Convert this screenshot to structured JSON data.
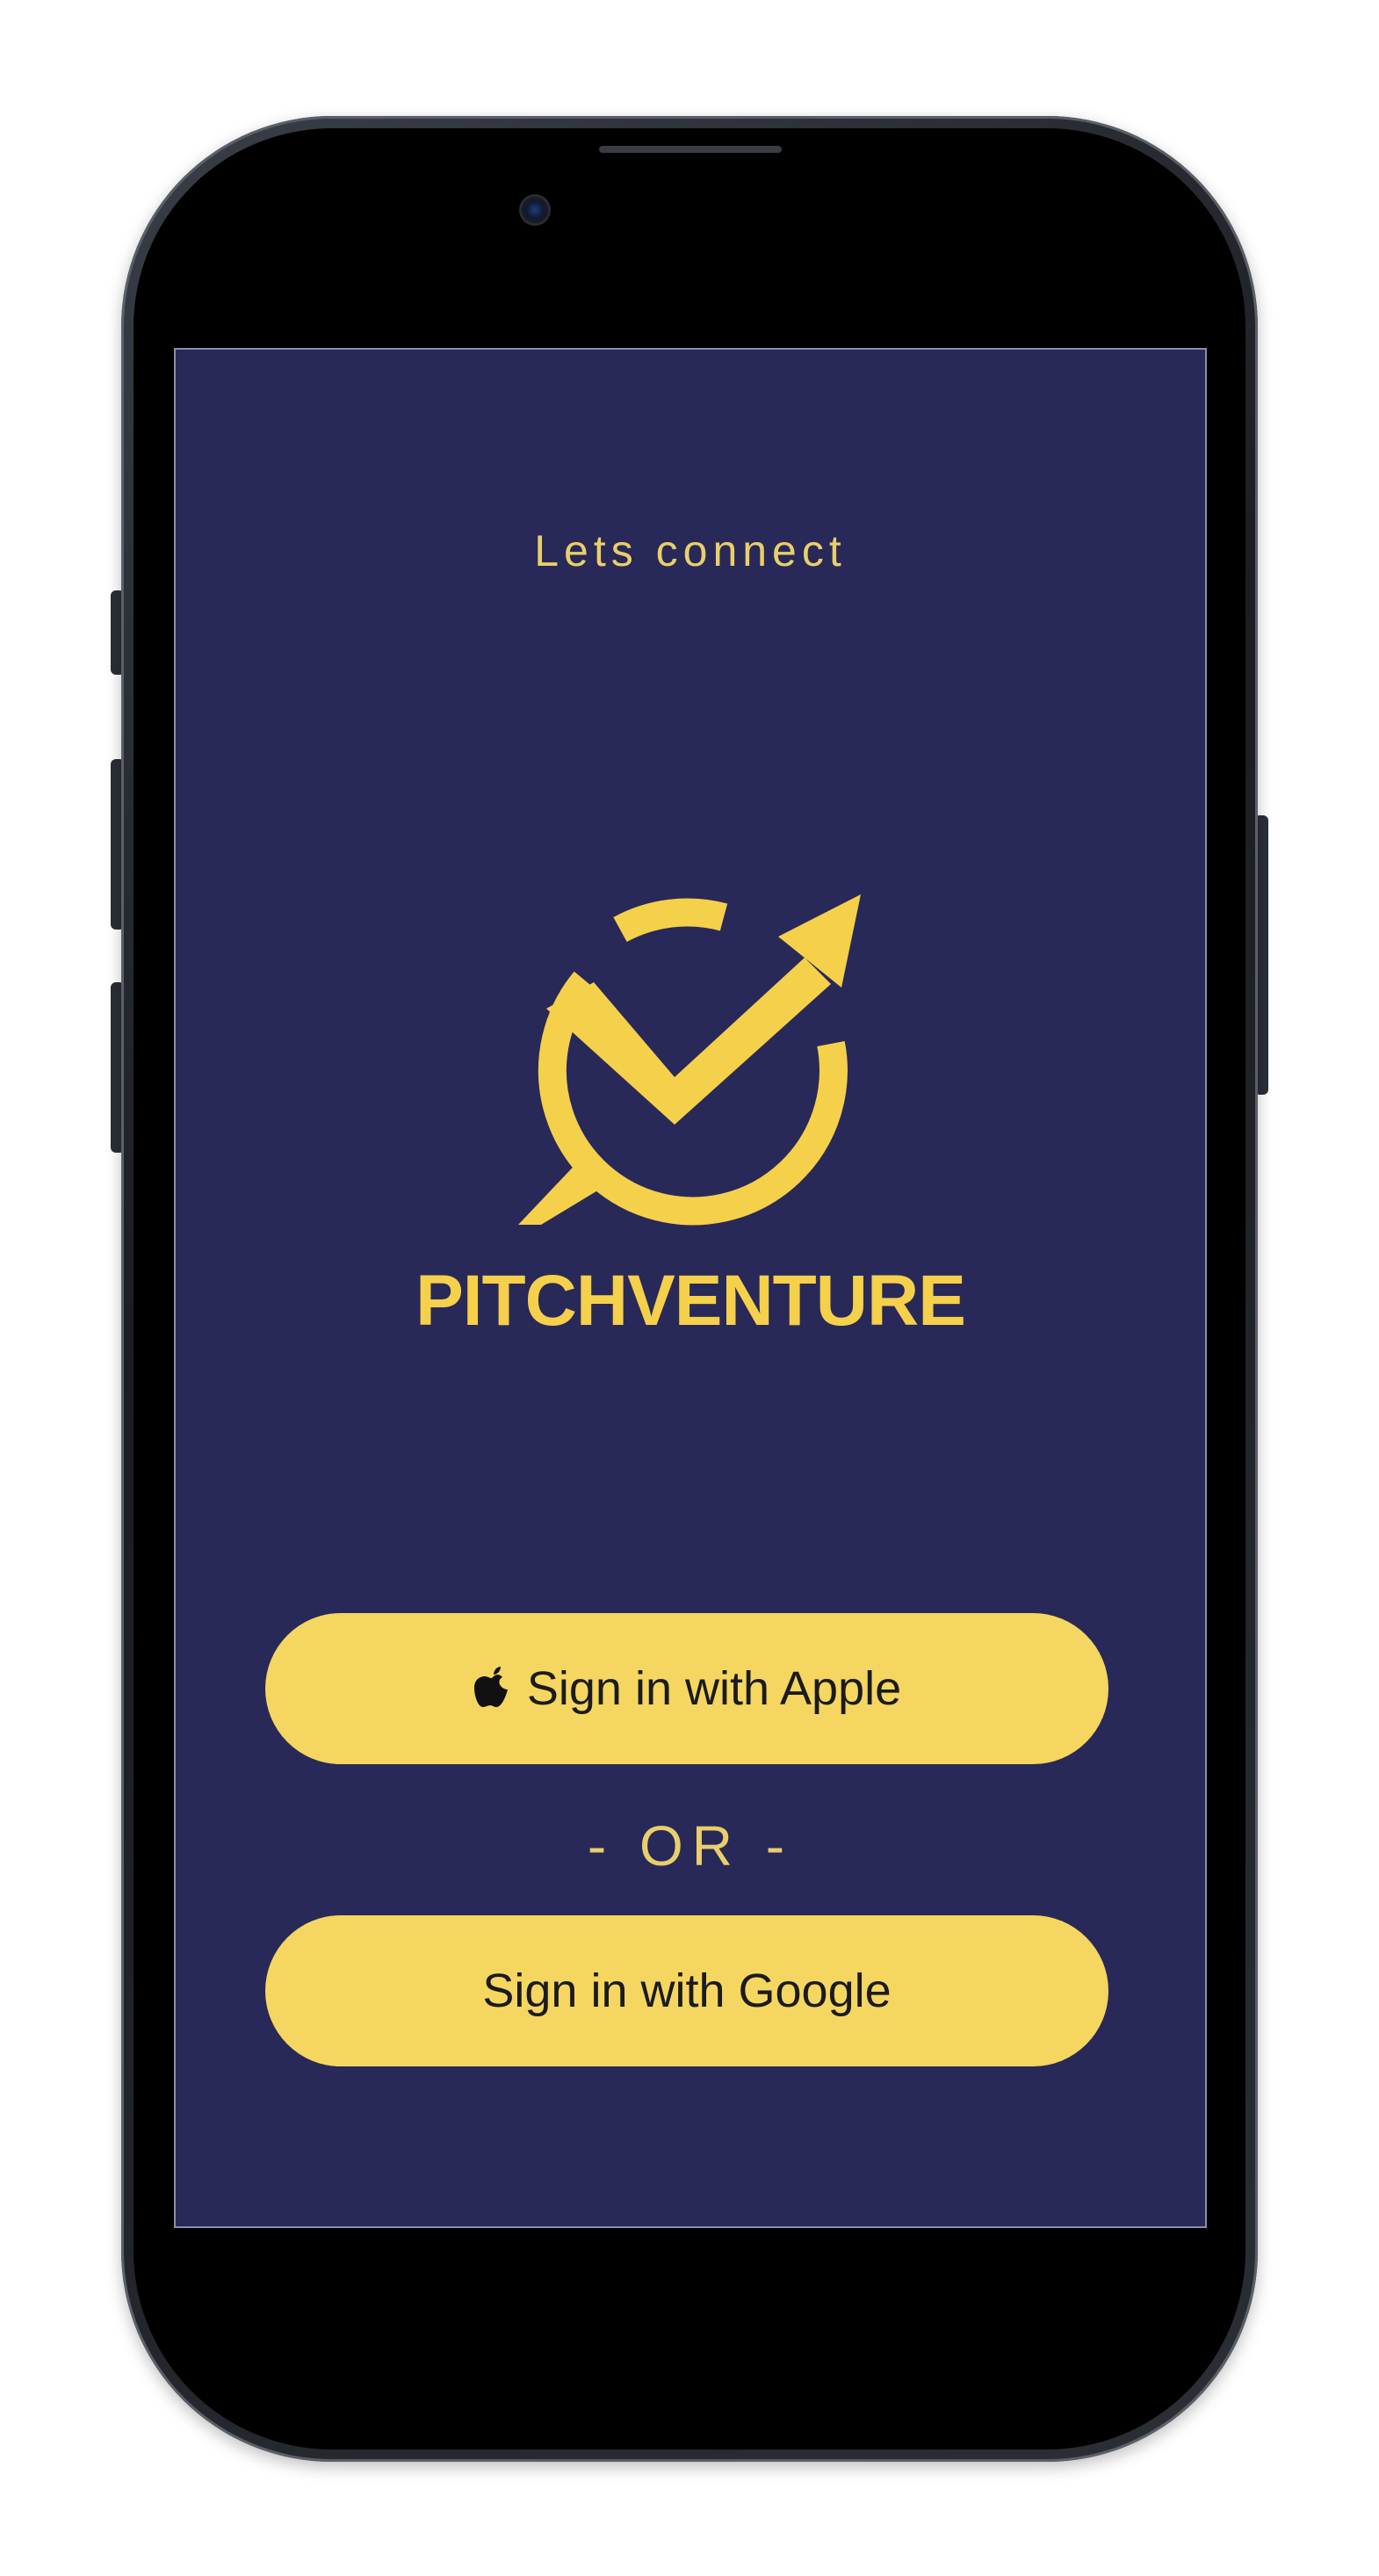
{
  "screen": {
    "title": "Lets connect",
    "brand_name": "PITCHVENTURE",
    "apple_button_label": "Sign in with Apple",
    "or_separator": "- OR -",
    "google_button_label": "Sign in with Google"
  },
  "colors": {
    "background": "#282958",
    "accent": "#f5d04a",
    "button": "#f5d660",
    "button_text": "#1b1b1f"
  },
  "icons": {
    "logo": "checkmark-arrow-circle-logo",
    "apple": "apple-icon"
  }
}
